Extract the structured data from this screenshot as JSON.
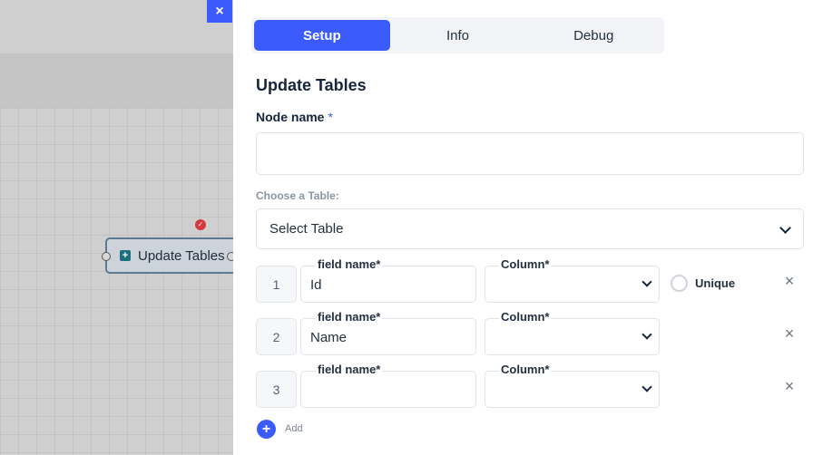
{
  "canvas": {
    "close_icon": "close-icon",
    "node": {
      "label": "Update Tables",
      "status_icon": "check-icon"
    }
  },
  "panel": {
    "tabs": [
      {
        "label": "Setup",
        "active": true
      },
      {
        "label": "Info",
        "active": false
      },
      {
        "label": "Debug",
        "active": false
      }
    ],
    "title": "Update Tables",
    "node_name": {
      "label": "Node name",
      "required_mark": "*",
      "value": ""
    },
    "choose_table": {
      "label": "Choose a Table:",
      "selected": "Select Table"
    },
    "rows": [
      {
        "index": "1",
        "field_label": "field name*",
        "field_value": "Id",
        "column_label": "Column*",
        "unique_label": "Unique"
      },
      {
        "index": "2",
        "field_label": "field name*",
        "field_value": "Name",
        "column_label": "Column*"
      },
      {
        "index": "3",
        "field_label": "field name*",
        "field_value": "",
        "column_label": "Column*"
      }
    ],
    "add_label": "Add",
    "accent_color": "#3b5bfd"
  }
}
